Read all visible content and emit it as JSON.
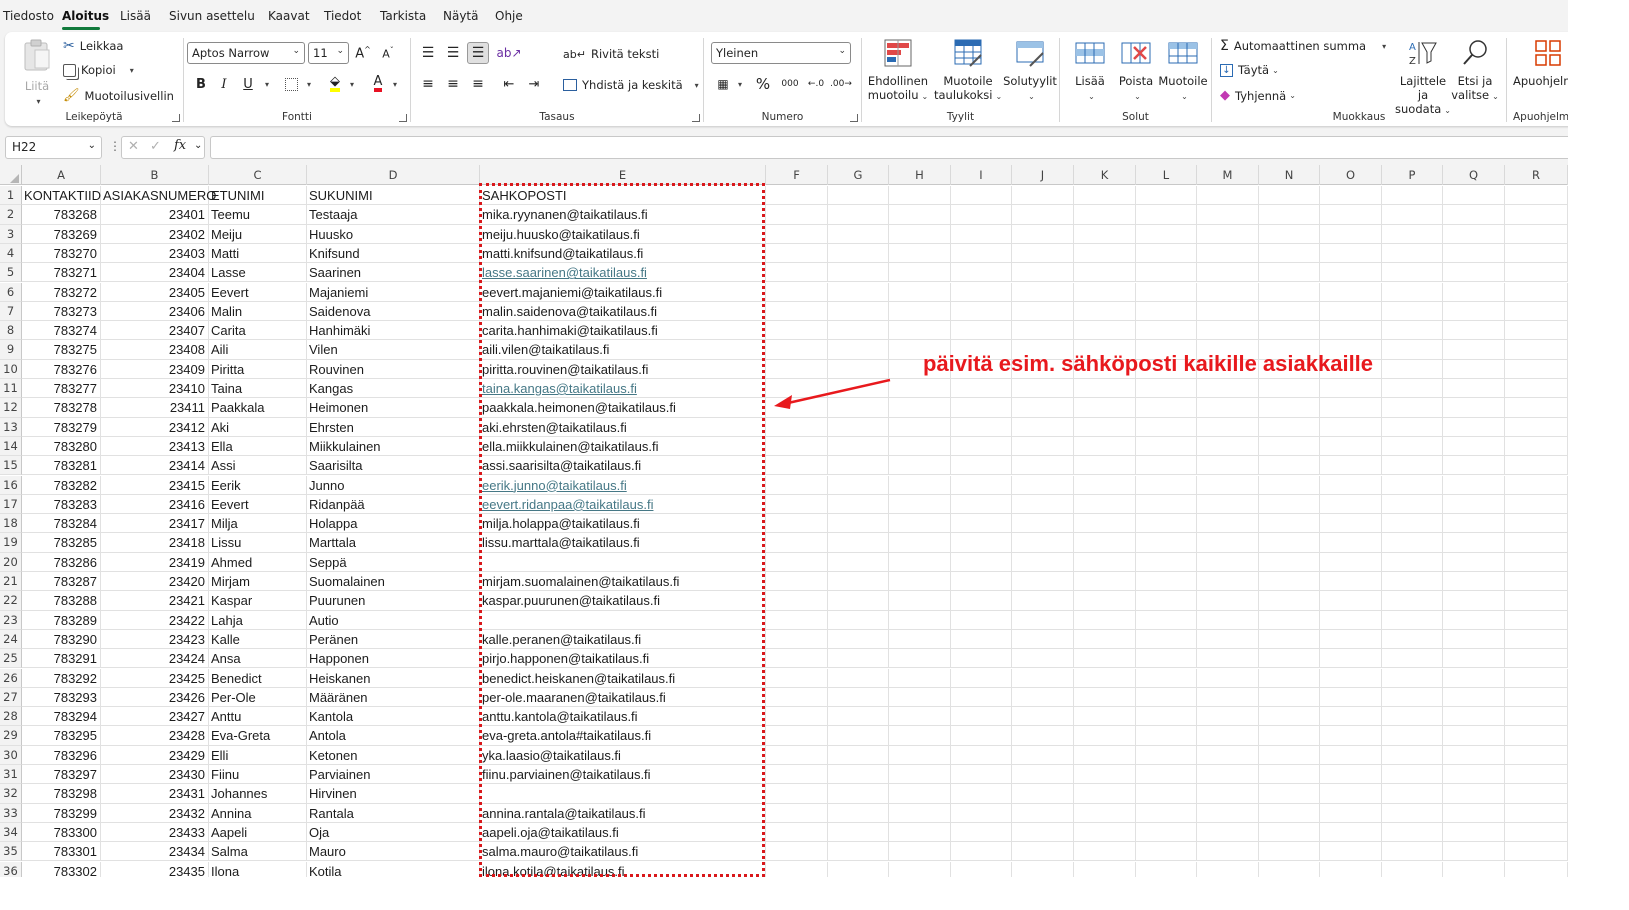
{
  "menu": {
    "tabs": [
      "Tiedosto",
      "Aloitus",
      "Lisää",
      "Sivun asettelu",
      "Kaavat",
      "Tiedot",
      "Tarkista",
      "Näytä",
      "Ohje"
    ],
    "active": "Aloitus"
  },
  "ribbon": {
    "clipboard": {
      "paste": "Liitä",
      "cut": "Leikkaa",
      "copy": "Kopioi",
      "format_painter": "Muotoilusivellin",
      "label": "Leikepöytä"
    },
    "font": {
      "family": "Aptos Narrow",
      "size": "11",
      "label": "Fontti",
      "bold": "B",
      "italic": "I",
      "underline": "U"
    },
    "alignment": {
      "wrap": "Rivitä teksti",
      "merge": "Yhdistä ja keskitä",
      "label": "Tasaus"
    },
    "number": {
      "format": "Yleinen",
      "percent": "%",
      "thousands": "000",
      "label": "Numero"
    },
    "styles": {
      "conditional": [
        "Ehdollinen",
        "muotoilu"
      ],
      "format_table": [
        "Muotoile",
        "taulukoksi"
      ],
      "cell_styles": "Solutyylit",
      "label": "Tyylit"
    },
    "cells": {
      "insert": "Lisää",
      "delete": "Poista",
      "format": "Muotoile",
      "label": "Solut"
    },
    "editing": {
      "autosum": "Automaattinen summa",
      "fill": "Täytä",
      "clear": "Tyhjennä",
      "sort": [
        "Lajittele ja",
        "suodata"
      ],
      "find": [
        "Etsi ja",
        "valitse"
      ],
      "label": "Muokkaus"
    },
    "addins": {
      "button": "Apuohjelmat",
      "label": "Apuohjelmat"
    }
  },
  "formula_bar": {
    "name_box": "H22",
    "fx": "fx",
    "formula": ""
  },
  "columns": [
    "A",
    "B",
    "C",
    "D",
    "E",
    "F",
    "G",
    "H",
    "I",
    "J",
    "K",
    "L",
    "M",
    "N",
    "O",
    "P",
    "Q",
    "R"
  ],
  "row_numbers": [
    "1",
    "2",
    "3",
    "4",
    "5",
    "6",
    "7",
    "8",
    "9",
    "10",
    "11",
    "12",
    "13",
    "14",
    "15",
    "16",
    "17",
    "18",
    "19",
    "20",
    "21",
    "22",
    "23",
    "24",
    "25",
    "26",
    "27",
    "28",
    "29",
    "30",
    "31",
    "32",
    "33",
    "34",
    "35",
    "36"
  ],
  "headers": [
    "KONTAKTIID",
    "ASIAKASNUMERO",
    "ETUNIMI",
    "SUKUNIMI",
    "SAHKOPOSTI"
  ],
  "data_rows": [
    [
      "783268",
      "23401",
      "Teemu",
      "Testaaja",
      "mika.ryynanen@taikatilaus.fi"
    ],
    [
      "783269",
      "23402",
      "Meiju",
      "Huusko",
      "meiju.huusko@taikatilaus.fi"
    ],
    [
      "783270",
      "23403",
      "Matti",
      "Knifsund",
      "matti.knifsund@taikatilaus.fi"
    ],
    [
      "783271",
      "23404",
      "Lasse",
      "Saarinen",
      "lasse.saarinen@taikatilaus.fi"
    ],
    [
      "783272",
      "23405",
      "Eevert",
      "Majaniemi",
      "eevert.majaniemi@taikatilaus.fi"
    ],
    [
      "783273",
      "23406",
      "Malin",
      "Saidenova",
      "malin.saidenova@taikatilaus.fi"
    ],
    [
      "783274",
      "23407",
      "Carita",
      "Hanhimäki",
      "carita.hanhimaki@taikatilaus.fi"
    ],
    [
      "783275",
      "23408",
      "Aili",
      "Vilen",
      "aili.vilen@taikatilaus.fi"
    ],
    [
      "783276",
      "23409",
      "Piritta",
      "Rouvinen",
      "piritta.rouvinen@taikatilaus.fi"
    ],
    [
      "783277",
      "23410",
      "Taina",
      "Kangas",
      "taina.kangas@taikatilaus.fi"
    ],
    [
      "783278",
      "23411",
      "Paakkala",
      "Heimonen",
      "paakkala.heimonen@taikatilaus.fi"
    ],
    [
      "783279",
      "23412",
      "Aki",
      "Ehrsten",
      "aki.ehrsten@taikatilaus.fi"
    ],
    [
      "783280",
      "23413",
      "Ella",
      "Miikkulainen",
      "ella.miikkulainen@taikatilaus.fi"
    ],
    [
      "783281",
      "23414",
      "Assi",
      "Saarisilta",
      "assi.saarisilta@taikatilaus.fi"
    ],
    [
      "783282",
      "23415",
      "Eerik",
      "Junno",
      "eerik.junno@taikatilaus.fi"
    ],
    [
      "783283",
      "23416",
      "Eevert",
      "Ridanpää",
      "eevert.ridanpaa@taikatilaus.fi"
    ],
    [
      "783284",
      "23417",
      "Milja",
      "Holappa",
      "milja.holappa@taikatilaus.fi"
    ],
    [
      "783285",
      "23418",
      "Lissu",
      "Marttala",
      "lissu.marttala@taikatilaus.fi"
    ],
    [
      "783286",
      "23419",
      "Ahmed",
      "Seppä",
      ""
    ],
    [
      "783287",
      "23420",
      "Mirjam",
      "Suomalainen",
      "mirjam.suomalainen@taikatilaus.fi"
    ],
    [
      "783288",
      "23421",
      "Kaspar",
      "Puurunen",
      "kaspar.puurunen@taikatilaus.fi"
    ],
    [
      "783289",
      "23422",
      "Lahja",
      "Autio",
      ""
    ],
    [
      "783290",
      "23423",
      "Kalle",
      "Peränen",
      "kalle.peranen@taikatilaus.fi"
    ],
    [
      "783291",
      "23424",
      "Ansa",
      "Happonen",
      "pirjo.happonen@taikatilaus.fi"
    ],
    [
      "783292",
      "23425",
      "Benedict",
      "Heiskanen",
      "benedict.heiskanen@taikatilaus.fi"
    ],
    [
      "783293",
      "23426",
      "Per-Ole",
      "Määränen",
      "per-ole.maaranen@taikatilaus.fi"
    ],
    [
      "783294",
      "23427",
      "Anttu",
      "Kantola",
      "anttu.kantola@taikatilaus.fi"
    ],
    [
      "783295",
      "23428",
      "Eva-Greta",
      "Antola",
      "eva-greta.antola#taikatilaus.fi"
    ],
    [
      "783296",
      "23429",
      "Elli",
      "Ketonen",
      "yka.laasio@taikatilaus.fi"
    ],
    [
      "783297",
      "23430",
      "Fiinu",
      "Parviainen",
      "fiinu.parviainen@taikatilaus.fi"
    ],
    [
      "783298",
      "23431",
      "Johannes",
      "Hirvinen",
      ""
    ],
    [
      "783299",
      "23432",
      "Annina",
      "Rantala",
      "annina.rantala@taikatilaus.fi"
    ],
    [
      "783300",
      "23433",
      "Aapeli",
      "Oja",
      "aapeli.oja@taikatilaus.fi"
    ],
    [
      "783301",
      "23434",
      "Salma",
      "Mauro",
      "salma.mauro@taikatilaus.fi"
    ],
    [
      "783302",
      "23435",
      "Ilona",
      "Kotila",
      "ilona.kotila@taikatilaus.fi"
    ]
  ],
  "hyperlink_rows": [
    5,
    11,
    16,
    17
  ],
  "annotation": "päivitä esim. sähköposti kaikille asiakkaille",
  "colors": {
    "accent": "#117a3c",
    "annotation": "#e8191d",
    "link": "#467886"
  }
}
